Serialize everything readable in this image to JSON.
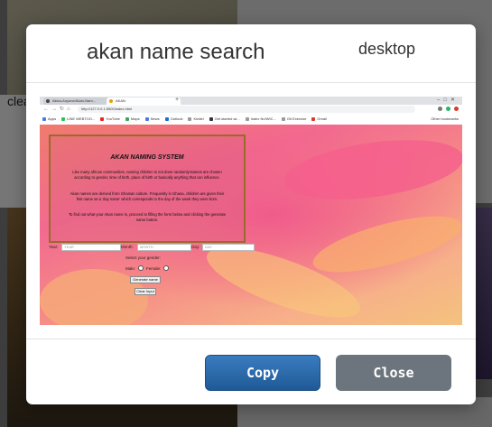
{
  "background": {
    "caption": "clea"
  },
  "modal": {
    "title": "akan name search",
    "tag": "desktop",
    "copy_label": "Copy",
    "close_label": "Close"
  },
  "preview": {
    "browser": {
      "tabs": [
        "Akica-Anyone/Akan-Nam...",
        "AKAN"
      ],
      "url": "http://127.0.0.1:5500/index.html",
      "bookmarks": [
        "Apps",
        "LINE WEBTOO...",
        "YouTube",
        "Maps",
        "News",
        "Outlook",
        "Kiralel",
        "Get started wi...",
        "Index Nri/WIC...",
        "Git Exercise",
        "Gmail"
      ],
      "other_bookmarks": "Other bookmarks"
    },
    "page": {
      "heading": "AKAN NAMING SYSTEM",
      "para1": "Like many african communities, naming children is not done randomly.Names are chosen according to gender, time of birth, place of birth or basically anything that can influence.",
      "para2": "Akan names are derived from Ghanian culture. Frequently in Ghana, children are given their first name as a 'day name' which corresponds to the day of the week they were born.",
      "para3": "To find out what your Akan name is, proceed to filling the form below and clicking the generate name button.",
      "year_label": "Year:",
      "year_placeholder": "YEAR",
      "month_label": "Month:",
      "month_placeholder": "MONTH",
      "day_label": "Day:",
      "day_placeholder": "DAY",
      "gender_prompt": "Select your gender:",
      "male_label": "Male:",
      "female_label": "Female:",
      "generate_label": "Generate name",
      "clear_label": "Clear Input"
    }
  },
  "colors": {
    "copy_button": "#2a6aad",
    "close_button": "#6c757d",
    "page_pink": "#f26a8f"
  }
}
